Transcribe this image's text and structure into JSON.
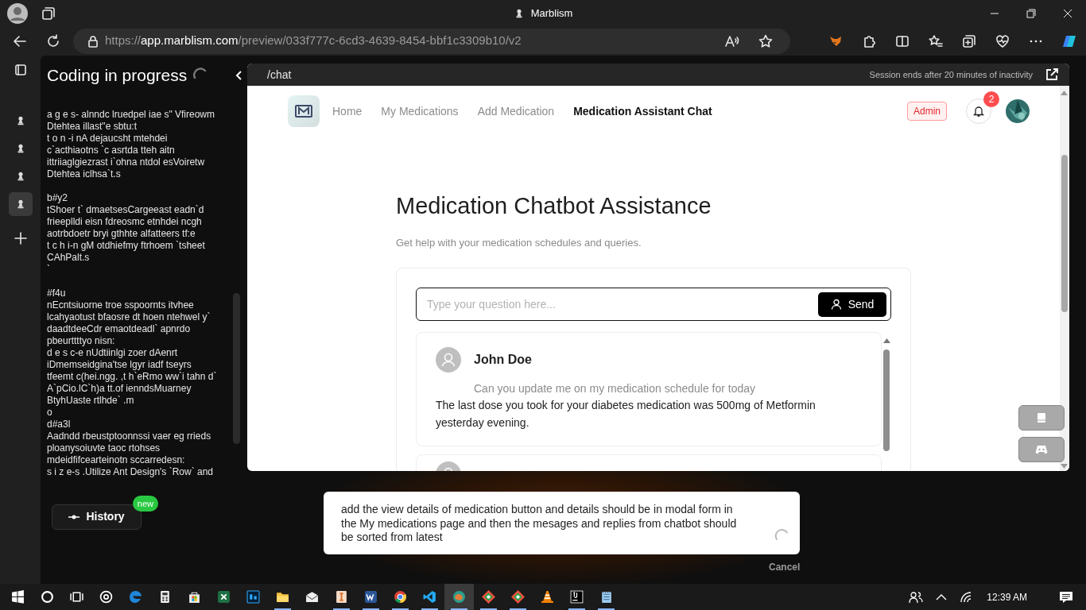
{
  "browser": {
    "title": "Marblism",
    "url": {
      "scheme": "https://",
      "host": "app.marblism.com",
      "path": "/preview/033f777c-6cd3-4639-8454-bbf1c3309b10/v2"
    }
  },
  "vertical_tabs": [
    {
      "selected": false
    },
    {
      "selected": false
    },
    {
      "selected": false
    },
    {
      "selected": true
    }
  ],
  "coding_panel": {
    "title": "Coding in progress",
    "log_blocks": [
      [
        "a g e s- alnndc lruedpel iae s\" Vfireowm",
        "Dtehtea illast\"e sbtu:t",
        "t o n -i nA dejaucsht mtehdei",
        "c`acthiaotns `c asrtda tteh aitn",
        "ittriiaglgiezrast i`ohna ntdol esVoiretw",
        "Dtehtea iclhsa`t.s"
      ],
      [
        "b#y2",
        "tShoer t` dmaetsesCargeeast eadn`d",
        "frieeplldi eisn fdreosmc etnhdei ncgh",
        "aotrbdoetr bryi gthhte alfatteers tf:e",
        "t c h i-n gM otdhiefmy ftrhoem `tsheet",
        "CAhPalt.s",
        "`"
      ],
      [
        "#f4u",
        "nEcntsiuorne troe sspoornts itvhee",
        "lcahyaotust bfaosre dt hoen ntehwel y`",
        "daadtdeeCdr emaotdeadl` apnrdo",
        "pbeurttttyo nisn:",
        "d e s c-e nUdtiinlgi zoer dAenrt",
        "iDmemseidgina'tse lgyr iadf tseyrs",
        "tfeemt c(hei.ngg. ,t h`eRmo ww`i tahn d`",
        "A`pCio.lC`h)a tt.of ienndsMuarney",
        "BtyhUaste rtlhde` .m",
        "o",
        "d#a3l",
        "Aadndd rbeustptoonnssi vaer eg rrieds",
        "ploanysoiuvte taoc rtohses",
        "mdeidfifcearteinotn sccarredesn:",
        "s i z e-s .Utilize Ant Design's `Row` and"
      ]
    ],
    "history_button": "History",
    "history_badge": "new"
  },
  "preview": {
    "route": "/chat",
    "session_notice": "Session ends after 20 minutes of inactivity",
    "nav": [
      {
        "label": "Home",
        "selected": false
      },
      {
        "label": "My Medications",
        "selected": false
      },
      {
        "label": "Add Medication",
        "selected": false
      },
      {
        "label": "Medication Assistant Chat",
        "selected": true
      }
    ],
    "role_badge": "Admin",
    "notification_count": "2",
    "heading": "Medication Chatbot Assistance",
    "subheading": "Get help with your medication schedules and queries.",
    "chat_input": {
      "placeholder": "Type your question here..."
    },
    "send_button": "Send",
    "messages": [
      {
        "author": "John Doe",
        "question": "Can you update me on my medication schedule for today",
        "answer": "The last dose you took for your diabetes medication was 500mg of Metformin yesterday evening."
      }
    ]
  },
  "prompt": {
    "text": "add the view details of medication button and details should be in modal form in the My medications page and then the mesages and replies from chatbot should be sorted from latest",
    "cancel": "Cancel"
  },
  "taskbar": {
    "apps": [
      {
        "kind": "start",
        "running": false,
        "selected": false
      },
      {
        "kind": "search",
        "running": false,
        "selected": false
      },
      {
        "kind": "taskview",
        "running": false,
        "selected": false
      },
      {
        "kind": "ring",
        "running": false,
        "selected": false
      },
      {
        "kind": "browser",
        "running": false,
        "selected": false
      },
      {
        "kind": "calculator",
        "running": false,
        "selected": false
      },
      {
        "kind": "store",
        "running": false,
        "selected": false
      },
      {
        "kind": "sheet",
        "running": false,
        "selected": false
      },
      {
        "kind": "photo",
        "running": false,
        "selected": false
      },
      {
        "kind": "folder",
        "running": true,
        "selected": false
      },
      {
        "kind": "mail",
        "running": false,
        "selected": false
      },
      {
        "kind": "bookmark",
        "running": true,
        "selected": false
      },
      {
        "kind": "doc",
        "running": true,
        "selected": false
      },
      {
        "kind": "chrome",
        "running": true,
        "selected": false
      },
      {
        "kind": "code",
        "running": true,
        "selected": false
      },
      {
        "kind": "browserdev",
        "running": true,
        "selected": true
      },
      {
        "kind": "diamond",
        "running": true,
        "selected": false
      },
      {
        "kind": "diamond",
        "running": true,
        "selected": false
      },
      {
        "kind": "cone",
        "running": false,
        "selected": false
      },
      {
        "kind": "ide",
        "running": true,
        "selected": false
      },
      {
        "kind": "notepad",
        "running": true,
        "selected": false
      }
    ],
    "clock": "12:39 AM"
  }
}
